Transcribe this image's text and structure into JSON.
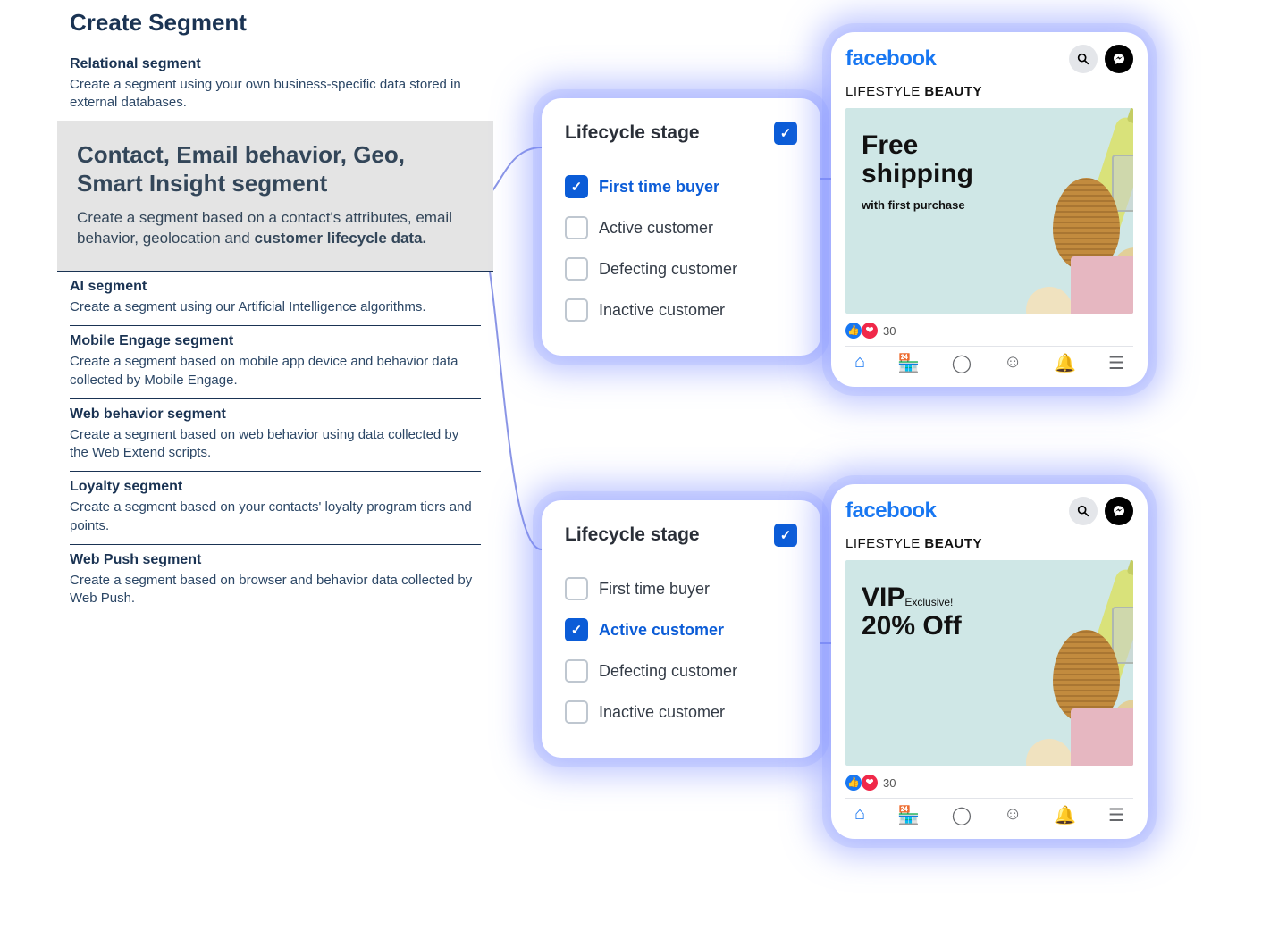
{
  "panel": {
    "title": "Create Segment",
    "items": [
      {
        "title": "Relational segment",
        "desc": "Create a segment using your own business-specific data stored in external databases."
      },
      {
        "title": "AI segment",
        "desc": "Create a segment using our Artificial Intelligence algorithms."
      },
      {
        "title": "Mobile Engage segment",
        "desc": "Create a segment based on mobile app device and behavior data collected by Mobile Engage."
      },
      {
        "title": "Web behavior segment",
        "desc": "Create a segment based on web behavior using data collected by the Web Extend scripts."
      },
      {
        "title": "Loyalty segment",
        "desc": "Create a segment based on your contacts' loyalty program tiers and points."
      },
      {
        "title": "Web Push segment",
        "desc": "Create a segment based on browser and behavior data collected by Web Push."
      }
    ],
    "highlight": {
      "title": "Contact, Email behavior, Geo, Smart Insight segment",
      "desc_pre": "Create a segment based on a contact's attributes, email behavior, geolocation and ",
      "desc_bold": "customer lifecycle data."
    }
  },
  "lifecycle": {
    "title": "Lifecycle stage",
    "options": [
      "First time buyer",
      "Active customer",
      "Defecting customer",
      "Inactive customer"
    ],
    "selected_top": "First time buyer",
    "selected_bot": "Active customer"
  },
  "fb": {
    "logo": "facebook",
    "brand_pre": "LIFESTYLE ",
    "brand_bold": "BEAUTY",
    "reactions": "30",
    "ad_top": {
      "h1a": "Free",
      "h1b": "shipping",
      "sub": "with first purchase"
    },
    "ad_bot": {
      "vip": "VIP",
      "excl": "Exclusive!",
      "off": "20% Off"
    }
  }
}
